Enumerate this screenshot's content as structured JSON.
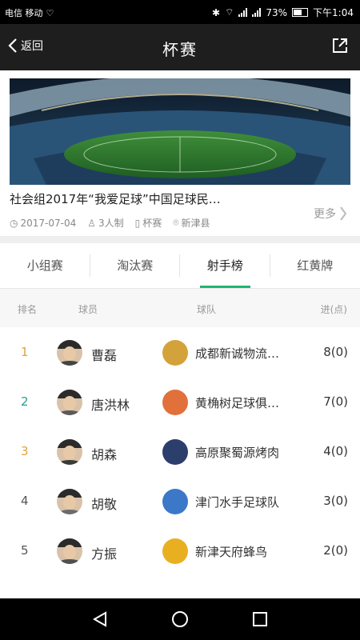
{
  "status_bar": {
    "left_text": "电信 移动",
    "battery": "73%",
    "time": "下午1:04",
    "battery_level": 0.73
  },
  "header": {
    "back_label": "返回",
    "title": "杯赛"
  },
  "match": {
    "title": "社会组2017年“我爱足球”中国足球民…",
    "date": "2017-07-04",
    "players": "3人制",
    "type": "杯赛",
    "location": "新津县",
    "more_label": "更多"
  },
  "tabs": [
    {
      "label": "小组赛"
    },
    {
      "label": "淘汰赛"
    },
    {
      "label": "射手榜",
      "active": true
    },
    {
      "label": "红黄牌"
    }
  ],
  "table": {
    "headers": {
      "rank": "排名",
      "player": "球员",
      "team": "球队",
      "goals": "进(点)"
    },
    "rows": [
      {
        "rank": "1",
        "player": "曹磊",
        "team": "成都新诚物流…",
        "goals": "8(0)",
        "rank_color": "#e5a23a",
        "logo_color": "#d4a23a",
        "shirt": "#444"
      },
      {
        "rank": "2",
        "player": "唐洪林",
        "team": "黄桷树足球俱…",
        "goals": "7(0)",
        "rank_color": "#2a9d8f",
        "logo_color": "#e2703a",
        "shirt": "#5a5a5a"
      },
      {
        "rank": "3",
        "player": "胡森",
        "team": "高原聚蜀源烤肉",
        "goals": "4(0)",
        "rank_color": "#e5a23a",
        "logo_color": "#2c3e6b",
        "shirt": "#3a3a3a"
      },
      {
        "rank": "4",
        "player": "胡敬",
        "team": "津门水手足球队",
        "goals": "3(0)",
        "rank_color": "#555555",
        "logo_color": "#3c78c8",
        "shirt": "#6b6b6b"
      },
      {
        "rank": "5",
        "player": "方振",
        "team": "新津天府蜂鸟",
        "goals": "2(0)",
        "rank_color": "#555555",
        "logo_color": "#e8b020",
        "shirt": "#505050"
      }
    ]
  },
  "colors": {
    "accent": "#22b573",
    "header_bg": "#1e1e1e"
  }
}
